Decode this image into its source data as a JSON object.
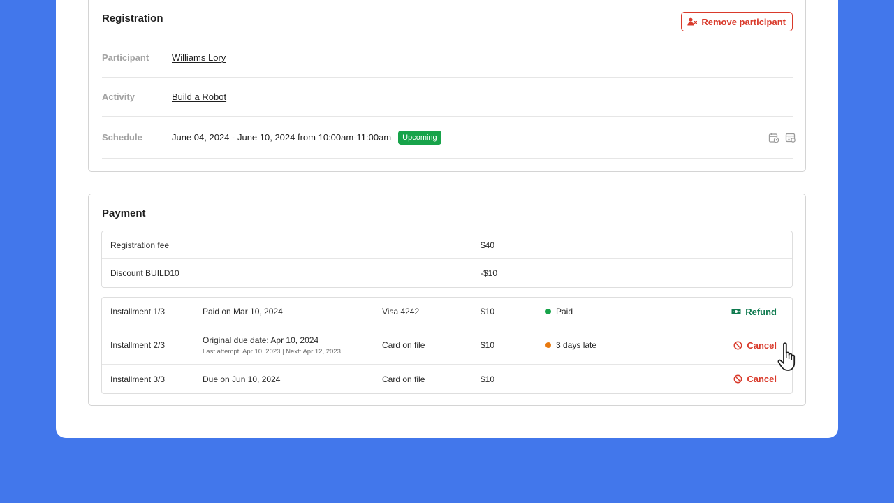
{
  "registration": {
    "title": "Registration",
    "remove_button_label": "Remove participant",
    "participant_label": "Participant",
    "participant_value": "Williams Lory",
    "activity_label": "Activity",
    "activity_value": "Build a Robot",
    "schedule_label": "Schedule",
    "schedule_value": "June 04, 2024 - June 10, 2024 from 10:00am-11:00am",
    "schedule_badge": "Upcoming"
  },
  "payment": {
    "title": "Payment",
    "fees": [
      {
        "label": "Registration fee",
        "amount": "$40"
      },
      {
        "label": "Discount BUILD10",
        "amount": "-$10"
      }
    ],
    "installments": [
      {
        "name": "Installment 1/3",
        "detail": "Paid on Mar 10, 2024",
        "subdetail": "",
        "method": "Visa 4242",
        "amount": "$10",
        "status": "Paid",
        "status_color": "#17a34a",
        "action": "Refund"
      },
      {
        "name": "Installment 2/3",
        "detail": "Original due date: Apr 10, 2024",
        "subdetail": "Last attempt: Apr 10, 2023 | Next: Apr 12, 2023",
        "method": "Card on file",
        "amount": "$10",
        "status": "3 days late",
        "status_color": "#e8790f",
        "action": "Cancel"
      },
      {
        "name": "Installment 3/3",
        "detail": "Due on Jun 10, 2024",
        "subdetail": "",
        "method": "Card on file",
        "amount": "$10",
        "status": "",
        "status_color": "",
        "action": "Cancel"
      }
    ]
  },
  "colors": {
    "background": "#4277eb",
    "danger": "#d93a2b",
    "success": "#17a34a",
    "warning": "#e8790f",
    "refund": "#0f7a4f"
  },
  "icons": [
    "remove-user-icon",
    "calendar-icon",
    "calendar-settings-icon",
    "money-icon",
    "cancel-icon",
    "hand-pointer-icon"
  ]
}
